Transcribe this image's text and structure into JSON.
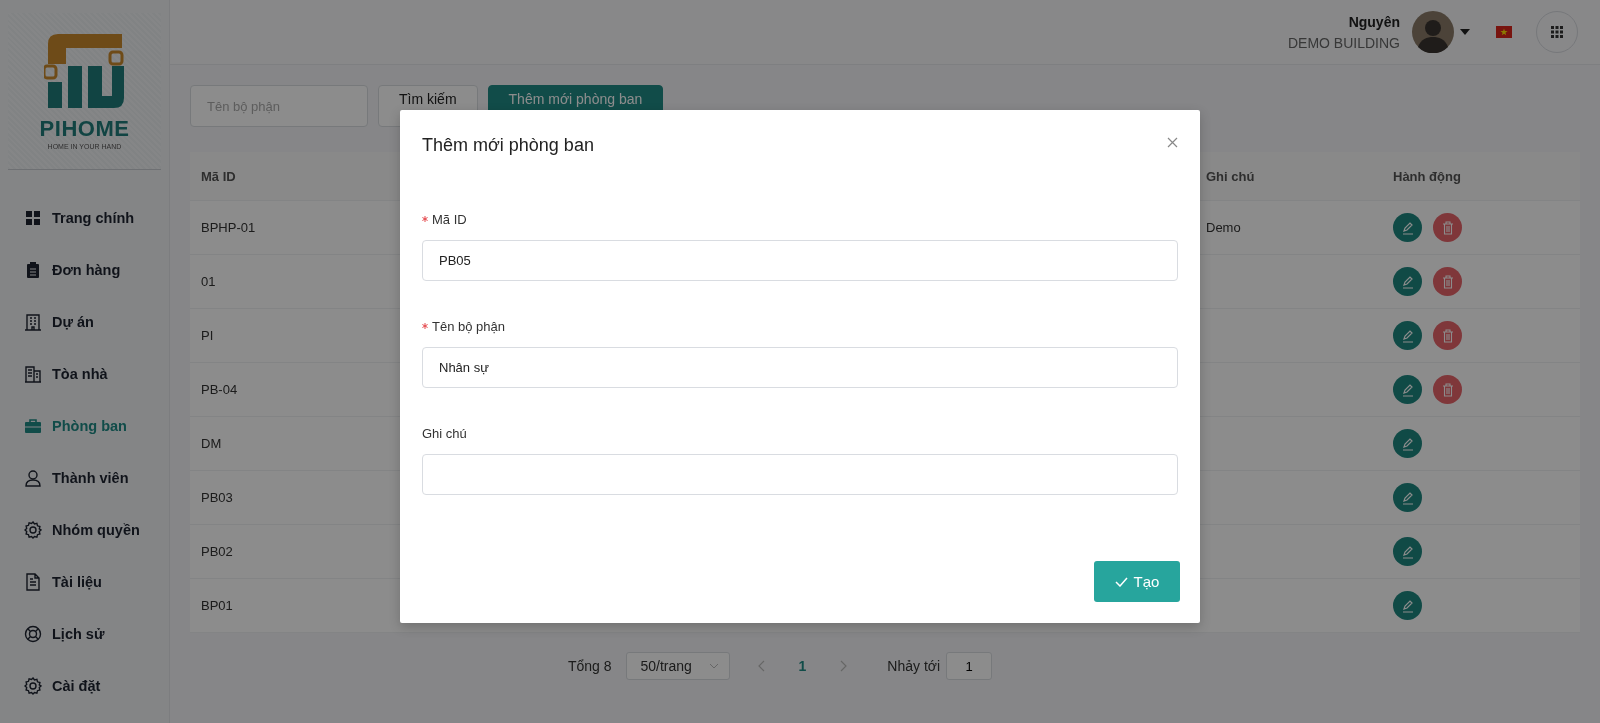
{
  "sidebar": {
    "logo": {
      "brand": "PIHOME",
      "tagline": "HOME IN YOUR HAND"
    },
    "items": [
      {
        "label": "Trang chính",
        "selected": false
      },
      {
        "label": "Đơn hàng",
        "selected": false
      },
      {
        "label": "Dự án",
        "selected": false
      },
      {
        "label": "Tòa nhà",
        "selected": false
      },
      {
        "label": "Phòng ban",
        "selected": true
      },
      {
        "label": "Thành viên",
        "selected": false
      },
      {
        "label": "Nhóm quyền",
        "selected": false
      },
      {
        "label": "Tài liệu",
        "selected": false
      },
      {
        "label": "Lịch sử",
        "selected": false
      },
      {
        "label": "Cài đặt",
        "selected": false
      }
    ]
  },
  "header": {
    "user_name": "Nguyên",
    "building": "DEMO BUILDING"
  },
  "toolbar": {
    "search": {
      "placeholder": "Tên bộ phận"
    },
    "buttons": [
      {
        "label": "Tìm kiếm",
        "kind": "default"
      },
      {
        "label": "Thêm mới phòng ban",
        "kind": "primary"
      }
    ]
  },
  "table": {
    "columns": [
      "Mã ID",
      "Ghi chú",
      "Hành động"
    ],
    "rows": [
      {
        "id": "BPHP-01",
        "note": "Demo",
        "deletable": true
      },
      {
        "id": "01",
        "deletable": true
      },
      {
        "id": "PI",
        "deletable": true
      },
      {
        "id": "PB-04",
        "deletable": true
      },
      {
        "id": "DM",
        "deletable": false
      },
      {
        "id": "PB03",
        "deletable": false
      },
      {
        "id": "PB02",
        "deletable": false
      },
      {
        "id": "BP01",
        "deletable": false
      }
    ]
  },
  "pagination": {
    "total": "Tổng 8",
    "page_size": "50/trang",
    "pages": [
      {
        "label": "1",
        "selected": true
      }
    ],
    "jump_label": "Nhảy tới",
    "jump_value": "1"
  },
  "modal": {
    "title": "Thêm mới phòng ban",
    "fields": [
      {
        "label": "Mã ID",
        "required": true,
        "value": "PB05"
      },
      {
        "label": "Tên bộ phận",
        "required": true,
        "value": "Nhân sự"
      },
      {
        "label": "Ghi chú",
        "required": false
      }
    ],
    "submit": "Tạo"
  }
}
